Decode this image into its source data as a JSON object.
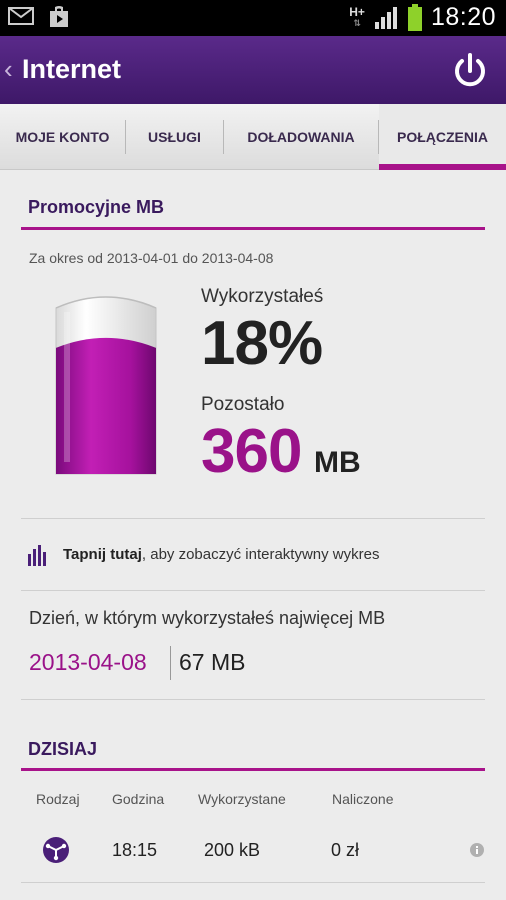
{
  "status_bar": {
    "network": "H+",
    "time": "18:20",
    "icons": [
      "mail-icon",
      "play-store-icon",
      "data-arrows-icon",
      "signal-icon",
      "battery-icon"
    ]
  },
  "app_bar": {
    "title": "Internet",
    "back_icon": "chevron-left-icon",
    "power_icon": "power-icon"
  },
  "tabs": [
    {
      "label": "MOJE KONTO",
      "active": false
    },
    {
      "label": "USŁUGI",
      "active": false
    },
    {
      "label": "DOŁADOWANIA",
      "active": false
    },
    {
      "label": "POŁĄCZENIA",
      "active": true
    }
  ],
  "promo": {
    "title": "Promocyjne MB",
    "period": "Za okres od 2013-04-01 do 2013-04-08",
    "used_label": "Wykorzystałeś",
    "used_value": "18%",
    "used_fraction": 0.18,
    "left_label": "Pozostało",
    "left_value": "360",
    "left_unit": "MB"
  },
  "tap": {
    "bold": "Tapnij tutaj",
    "rest": ", aby zobaczyć interaktywny wykres"
  },
  "max_day": {
    "label": "Dzień, w którym wykorzystałeś najwięcej MB",
    "date": "2013-04-08",
    "mb": "67 MB"
  },
  "today": {
    "title": "DZISIAJ",
    "columns": [
      "Rodzaj",
      "Godzina",
      "Wykorzystane",
      "Naliczone"
    ],
    "rows": [
      {
        "type_icon": "data-transfer-icon",
        "time": "18:15",
        "used": "200 kB",
        "charged": "0 zł"
      }
    ]
  },
  "colors": {
    "accent": "#a8138a",
    "header": "#4a1f78",
    "title_text": "#3a1a5e"
  }
}
